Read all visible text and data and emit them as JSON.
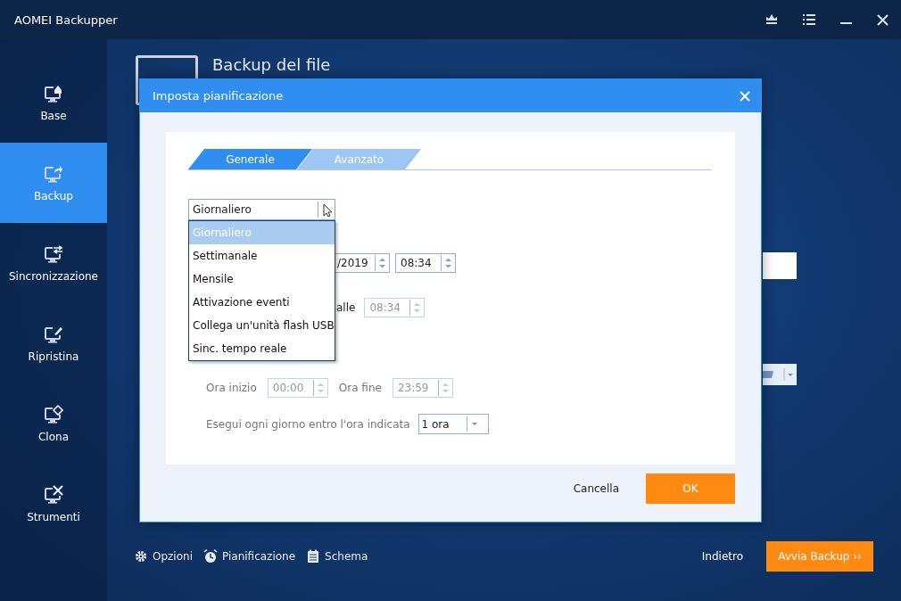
{
  "window": {
    "title": "AOMEI Backupper"
  },
  "sidebar": {
    "items": [
      {
        "label": "Base",
        "selected": false
      },
      {
        "label": "Backup",
        "selected": true
      },
      {
        "label": "Sincronizzazione",
        "selected": false
      },
      {
        "label": "Ripristina",
        "selected": false
      },
      {
        "label": "Clona",
        "selected": false
      },
      {
        "label": "Strumenti",
        "selected": false
      }
    ]
  },
  "page": {
    "title": "Backup del file"
  },
  "footer": {
    "links": [
      "Opzioni",
      "Pianificazione",
      "Schema"
    ],
    "back": "Indietro",
    "start": "Avvia Backup ››"
  },
  "dialog": {
    "title": "Imposta pianificazione",
    "tabs": [
      {
        "label": "Generale",
        "selected": true
      },
      {
        "label": "Avanzato",
        "selected": false
      }
    ],
    "frequency": {
      "value": "Giornaliero",
      "expanded": true,
      "options": [
        {
          "label": "Giornaliero",
          "selected": true
        },
        {
          "label": "Settimanale",
          "selected": false
        },
        {
          "label": "Mensile",
          "selected": false
        },
        {
          "label": "Attivazione eventi",
          "selected": false
        },
        {
          "label": "Collega un'unità flash USB",
          "selected": false
        },
        {
          "label": "Sinc. tempo reale",
          "selected": false
        }
      ]
    },
    "start_row": {
      "date": "/2019",
      "time": "08:34"
    },
    "repeat_row": {
      "label": "alle",
      "time": "08:34",
      "disabled": true
    },
    "range": {
      "start_label": "Ora inizio",
      "start": "00:00",
      "end_label": "Ora fine",
      "end": "23:59",
      "disabled": true
    },
    "interval": {
      "label": "Esegui ogni giorno entro l'ora indicata",
      "value": "1 ora"
    },
    "buttons": {
      "cancel": "Cancella",
      "ok": "OK"
    }
  }
}
